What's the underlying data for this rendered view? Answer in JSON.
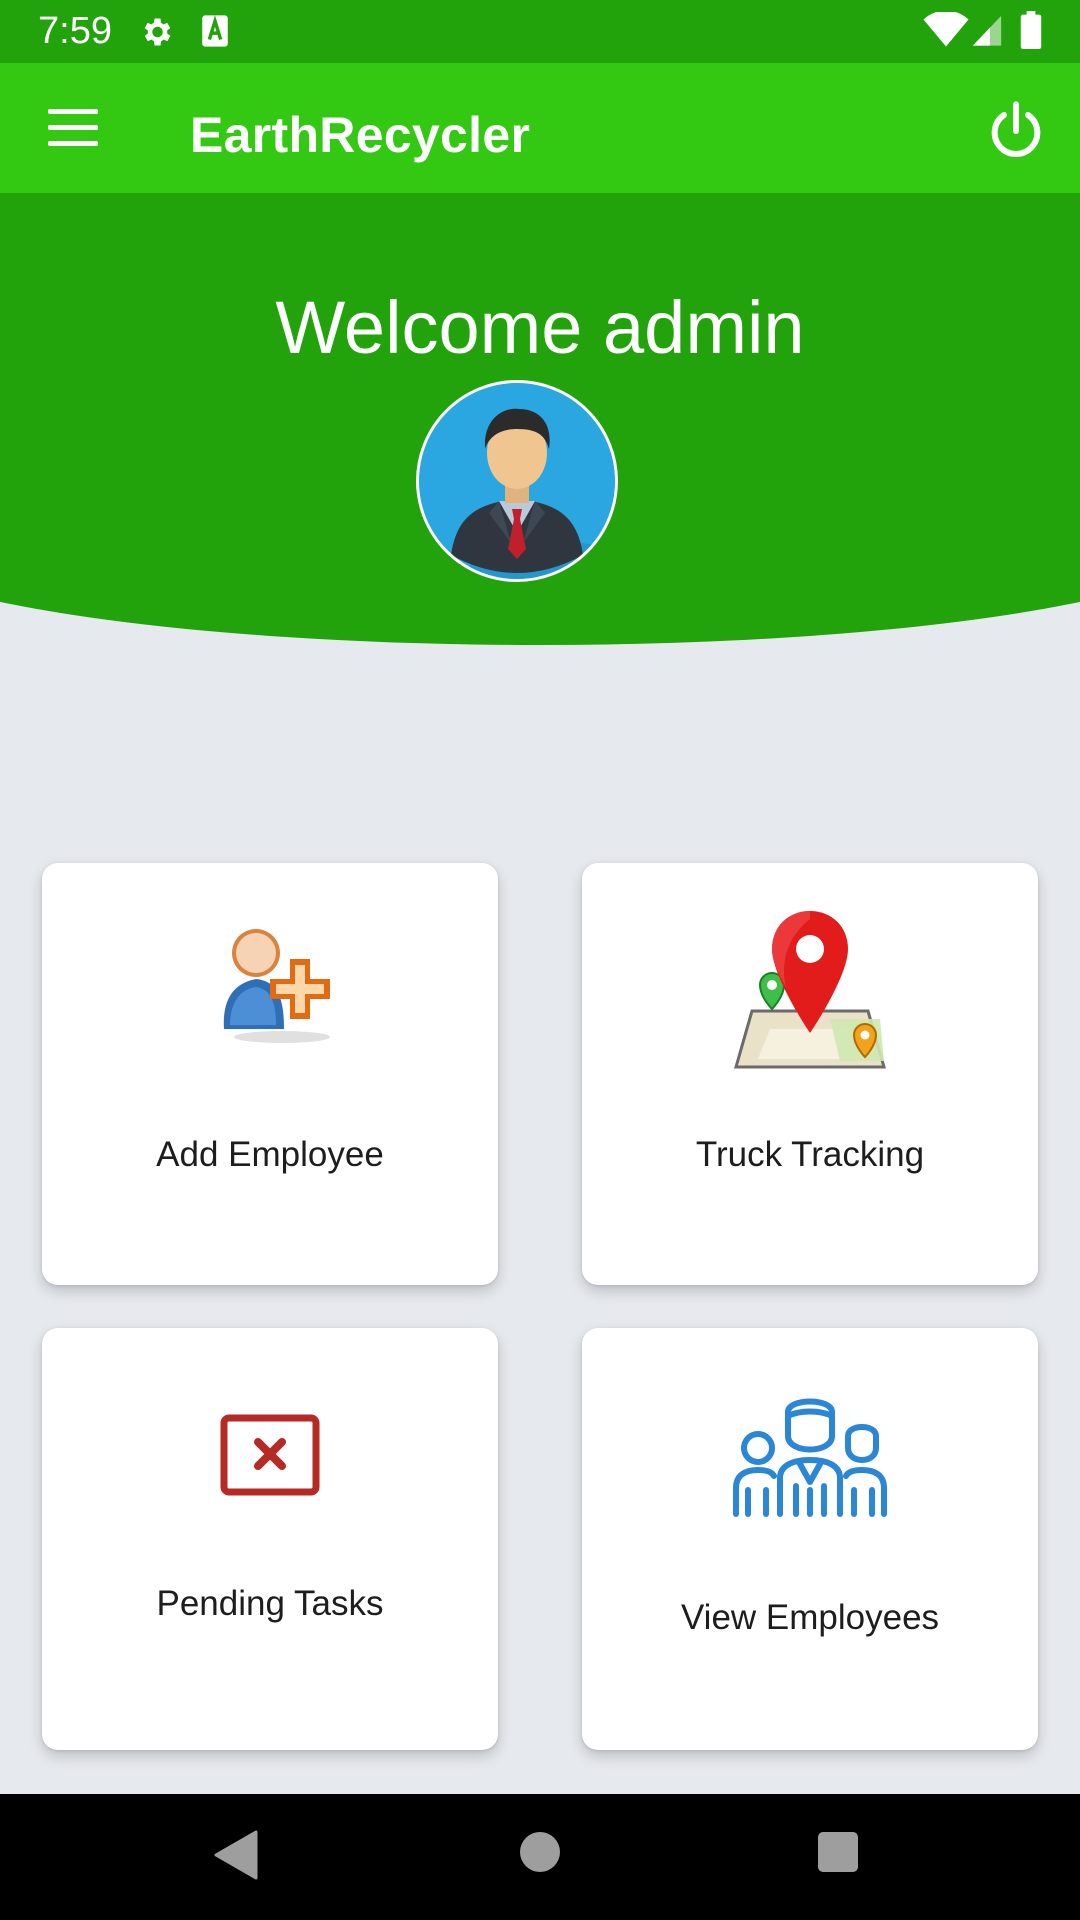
{
  "status_bar": {
    "time": "7:59",
    "icons": [
      "gear-icon",
      "a-box-icon",
      "wifi-icon",
      "signal-icon",
      "battery-icon"
    ]
  },
  "app_bar": {
    "title": "EarthRecycler",
    "menu_icon": "hamburger-menu-icon",
    "power_icon": "power-icon"
  },
  "header": {
    "welcome_text": "Welcome admin",
    "avatar_icon": "businessman-avatar-icon"
  },
  "cards": [
    {
      "label": "Add Employee",
      "icon": "add-user-icon"
    },
    {
      "label": "Truck Tracking",
      "icon": "map-pin-icon"
    },
    {
      "label": "Pending Tasks",
      "icon": "cross-box-icon"
    },
    {
      "label": "View Employees",
      "icon": "team-icon"
    }
  ],
  "nav_bar": {
    "icons": [
      "back-icon",
      "home-icon",
      "recents-icon"
    ]
  },
  "colors": {
    "status_bar": "#22a20b",
    "app_bar": "#33c812",
    "header": "#22a20b",
    "background": "#e6e9ee",
    "pending_red": "#b52a24",
    "team_blue": "#2b86d6"
  }
}
